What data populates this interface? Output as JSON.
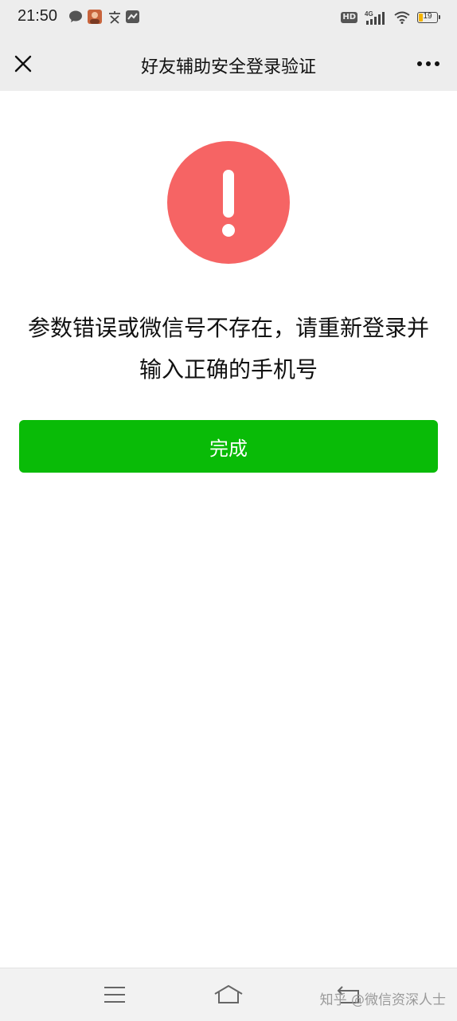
{
  "status_bar": {
    "time": "21:50",
    "network": "4G",
    "hd": "HD",
    "battery": "19",
    "app_icons": [
      "wechat-bubble-icon",
      "avatar-icon",
      "text-icon",
      "message-app-icon"
    ]
  },
  "nav": {
    "title": "好友辅助安全登录验证",
    "close_icon": "close-icon",
    "more_icon": "more-icon"
  },
  "main": {
    "icon": "warning-icon",
    "icon_color": "#f66464",
    "message": "参数错误或微信号不存在，请重新登录并输入正确的手机号",
    "button_label": "完成",
    "button_color": "#09bb07"
  },
  "system_nav": {
    "menu_icon": "menu-icon",
    "home_icon": "home-icon",
    "back_icon": "back-icon"
  },
  "watermark": "知乎 @微信资深人士"
}
